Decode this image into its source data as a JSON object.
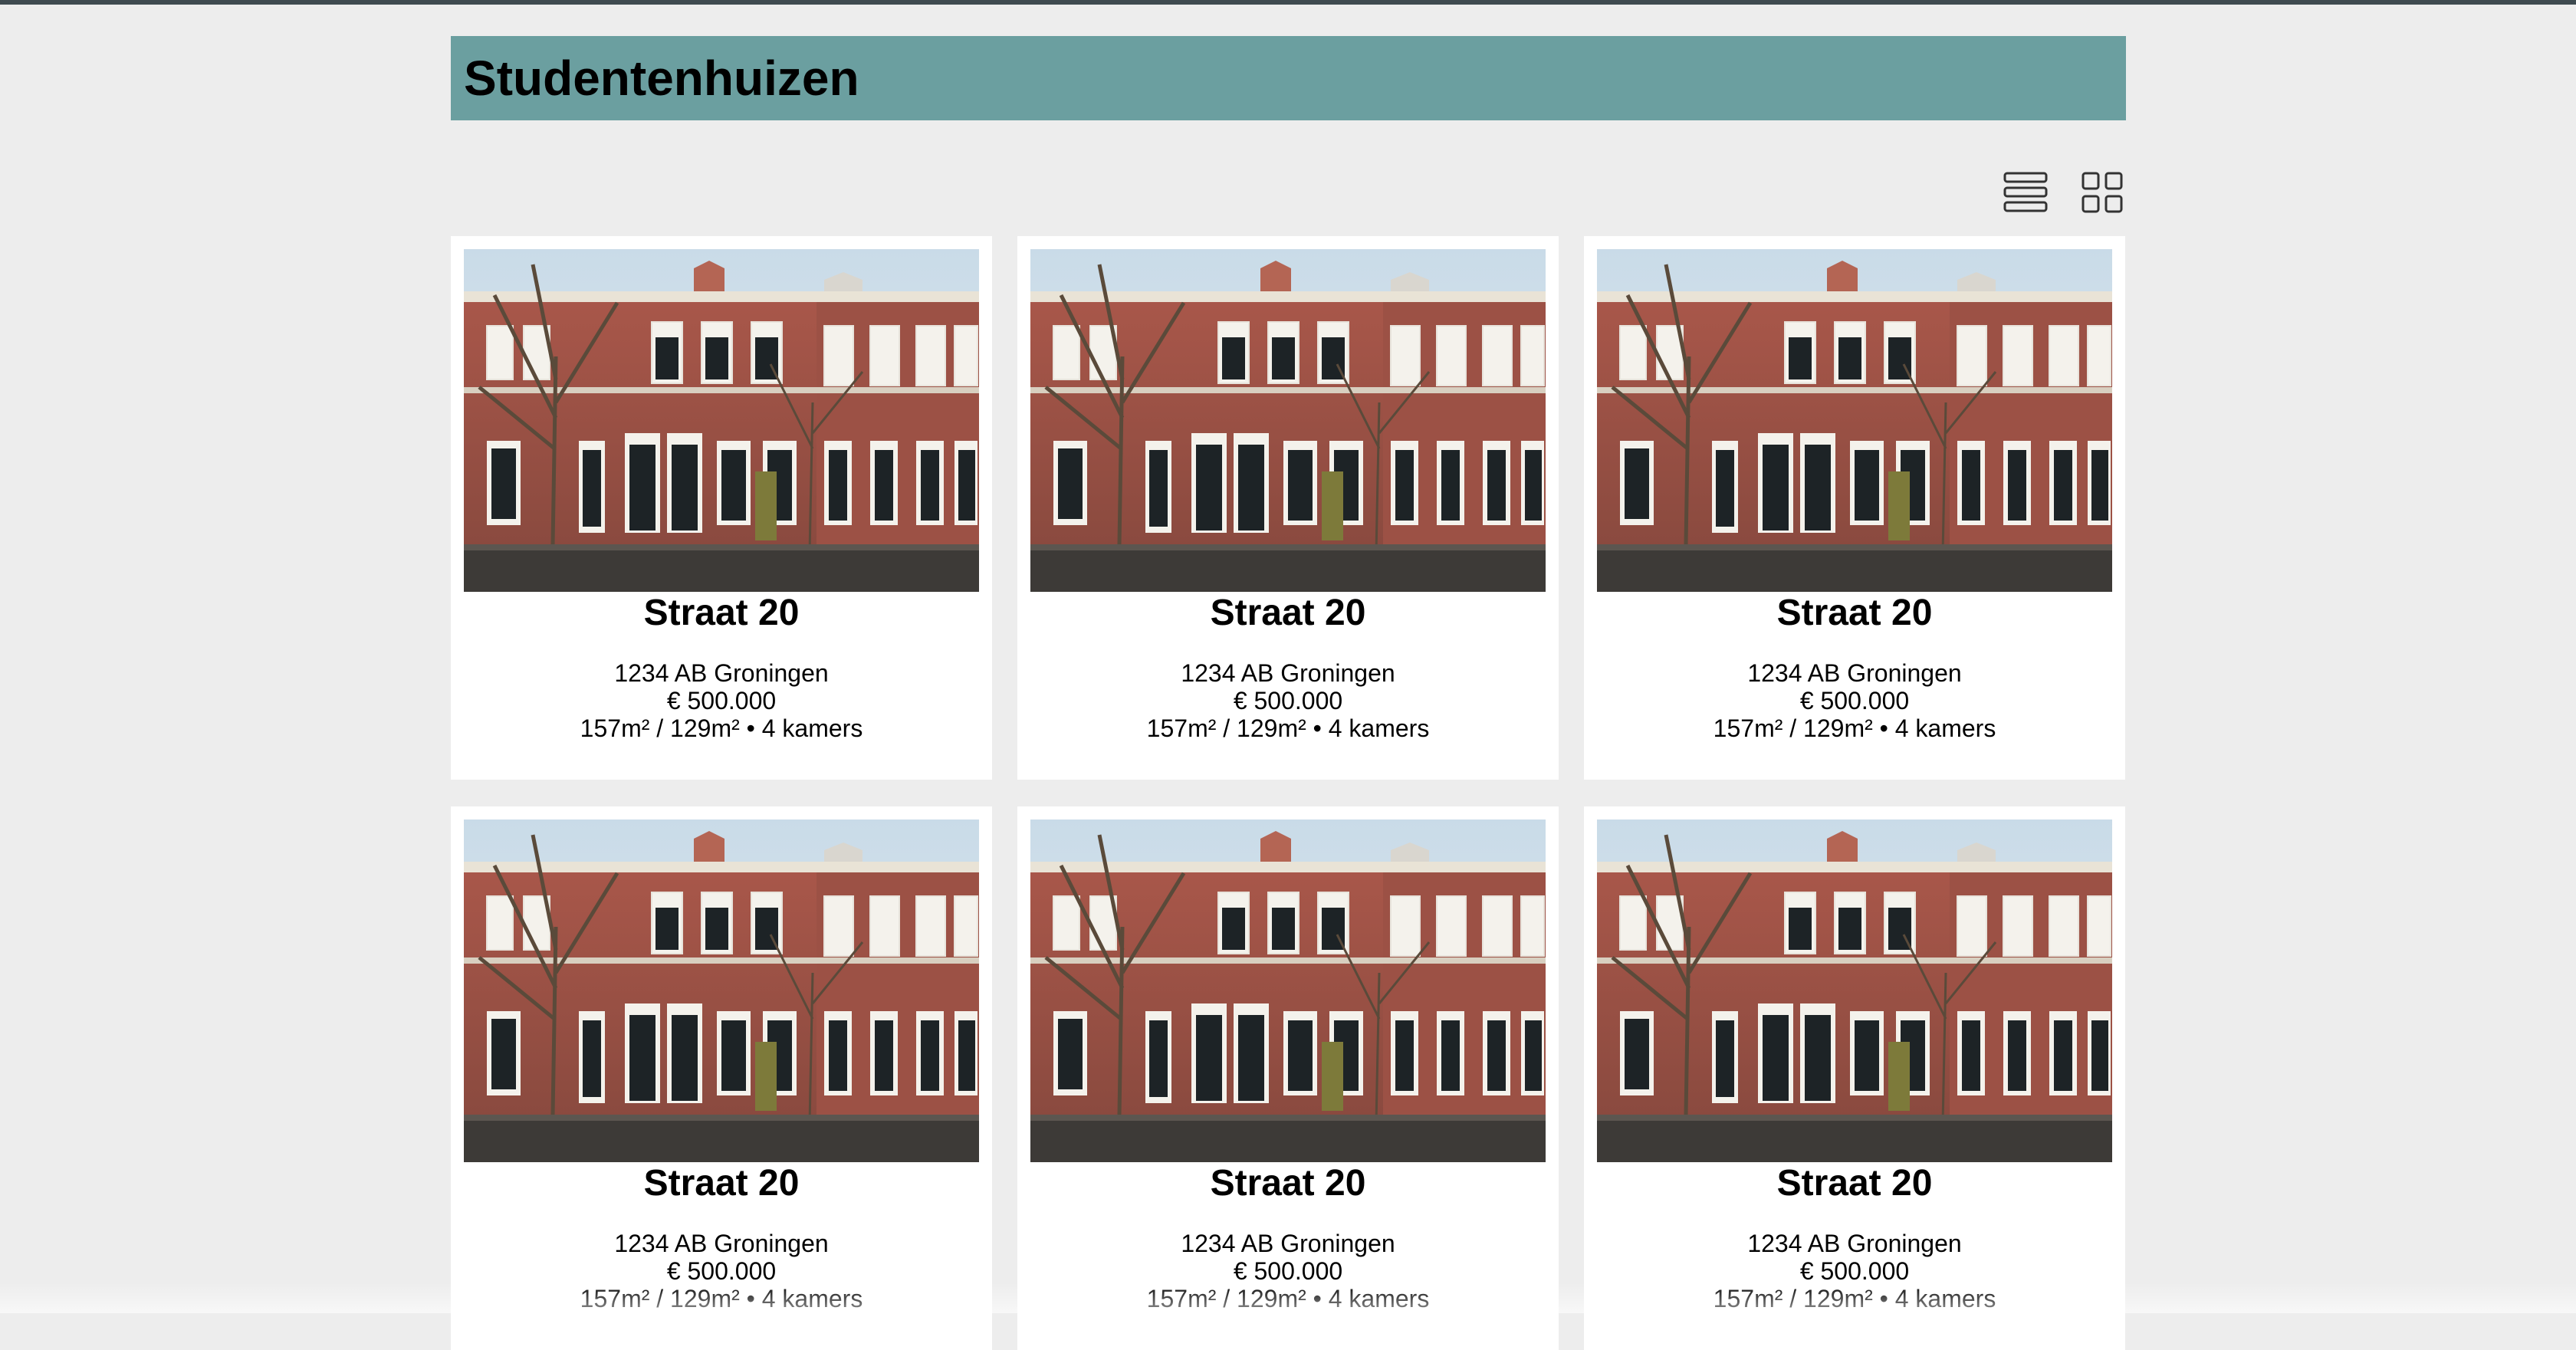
{
  "header": {
    "title": "Studentenhuizen"
  },
  "view_toggle": {
    "list_icon": "list-view-icon",
    "grid_icon": "grid-view-icon"
  },
  "colors": {
    "header_bg": "#6b9fa0",
    "page_bg": "#ededed",
    "card_bg": "#ffffff"
  },
  "listings": [
    {
      "title": "Straat 20",
      "address": "1234 AB Groningen",
      "price": "€ 500.000",
      "specs": "157m² / 129m² • 4 kamers"
    },
    {
      "title": "Straat 20",
      "address": "1234 AB Groningen",
      "price": "€ 500.000",
      "specs": "157m² / 129m² • 4 kamers"
    },
    {
      "title": "Straat 20",
      "address": "1234 AB Groningen",
      "price": "€ 500.000",
      "specs": "157m² / 129m² • 4 kamers"
    },
    {
      "title": "Straat 20",
      "address": "1234 AB Groningen",
      "price": "€ 500.000",
      "specs": "157m² / 129m² • 4 kamers"
    },
    {
      "title": "Straat 20",
      "address": "1234 AB Groningen",
      "price": "€ 500.000",
      "specs": "157m² / 129m² • 4 kamers"
    },
    {
      "title": "Straat 20",
      "address": "1234 AB Groningen",
      "price": "€ 500.000",
      "specs": "157m² / 129m² • 4 kamers"
    }
  ]
}
